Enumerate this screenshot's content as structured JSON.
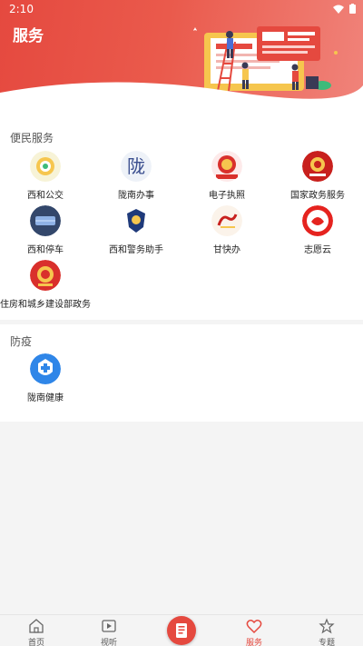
{
  "status": {
    "time": "2:10"
  },
  "header": {
    "title": "服务"
  },
  "sections": [
    {
      "title": "便民服务",
      "items": [
        {
          "label": "西和公交",
          "icon": "bus-badge-icon"
        },
        {
          "label": "陇南办事",
          "icon": "longnan-calligraphy-icon"
        },
        {
          "label": "电子执照",
          "icon": "national-emblem-license-icon"
        },
        {
          "label": "国家政务服务",
          "icon": "national-emblem-gov-service-icon"
        },
        {
          "label": "西和停车",
          "icon": "parking-icon"
        },
        {
          "label": "西和警务助手",
          "icon": "police-badge-icon"
        },
        {
          "label": "甘快办",
          "icon": "gankuaiban-logo-icon"
        },
        {
          "label": "志愿云",
          "icon": "volunteer-cloud-icon"
        },
        {
          "label": "住房和城乡建设部政务",
          "icon": "national-emblem-housing-icon"
        }
      ]
    },
    {
      "title": "防疫",
      "items": [
        {
          "label": "陇南健康",
          "icon": "health-code-icon"
        }
      ]
    }
  ],
  "tabbar": {
    "items": [
      {
        "label": "首页",
        "icon": "home-icon"
      },
      {
        "label": "视听",
        "icon": "video-icon"
      },
      {
        "label": "服务",
        "icon": "heart-icon",
        "active": true
      },
      {
        "label": "专题",
        "icon": "badge-star-icon"
      }
    ],
    "center_icon": "news-icon"
  },
  "colors": {
    "accent": "#e5493f",
    "background": "#f4f4f4"
  }
}
